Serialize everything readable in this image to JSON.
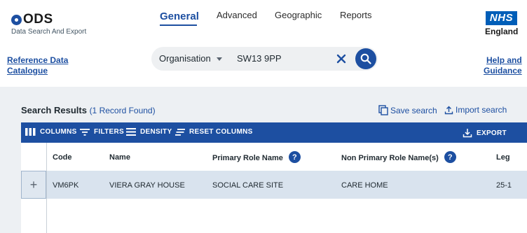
{
  "logo": {
    "title": "ODS",
    "subtitle": "Data Search And Export"
  },
  "nav": {
    "items": [
      "General",
      "Advanced",
      "Geographic",
      "Reports"
    ],
    "active": "General"
  },
  "brand": {
    "badge": "NHS",
    "org": "England"
  },
  "links": {
    "reference": [
      "Reference Data",
      "Catalogue"
    ],
    "help": [
      "Help and",
      "Guidance"
    ]
  },
  "search": {
    "type": "Organisation",
    "value": "SW13 9PP"
  },
  "results": {
    "title": "Search Results",
    "count": "(1 Record Found)",
    "save": "Save search",
    "import": "Import search"
  },
  "toolbar": {
    "columns": "COLUMNS",
    "filters": "FILTERS",
    "density": "DENSITY",
    "reset": "RESET COLUMNS",
    "export": "EXPORT"
  },
  "table": {
    "headers": [
      "Code",
      "Name",
      "Primary Role Name",
      "Non Primary Role Name(s)",
      "Leg"
    ],
    "rows": [
      {
        "expand": "+",
        "cells": [
          "VM6PK",
          "VIERA GRAY HOUSE",
          "SOCIAL CARE SITE",
          "CARE HOME",
          "25-1"
        ]
      }
    ]
  },
  "colors": {
    "primary": "#1d4fa1",
    "nhs_blue": "#005eb8",
    "row_highlight": "#d9e3ee",
    "page_bg": "#edf0f3"
  }
}
